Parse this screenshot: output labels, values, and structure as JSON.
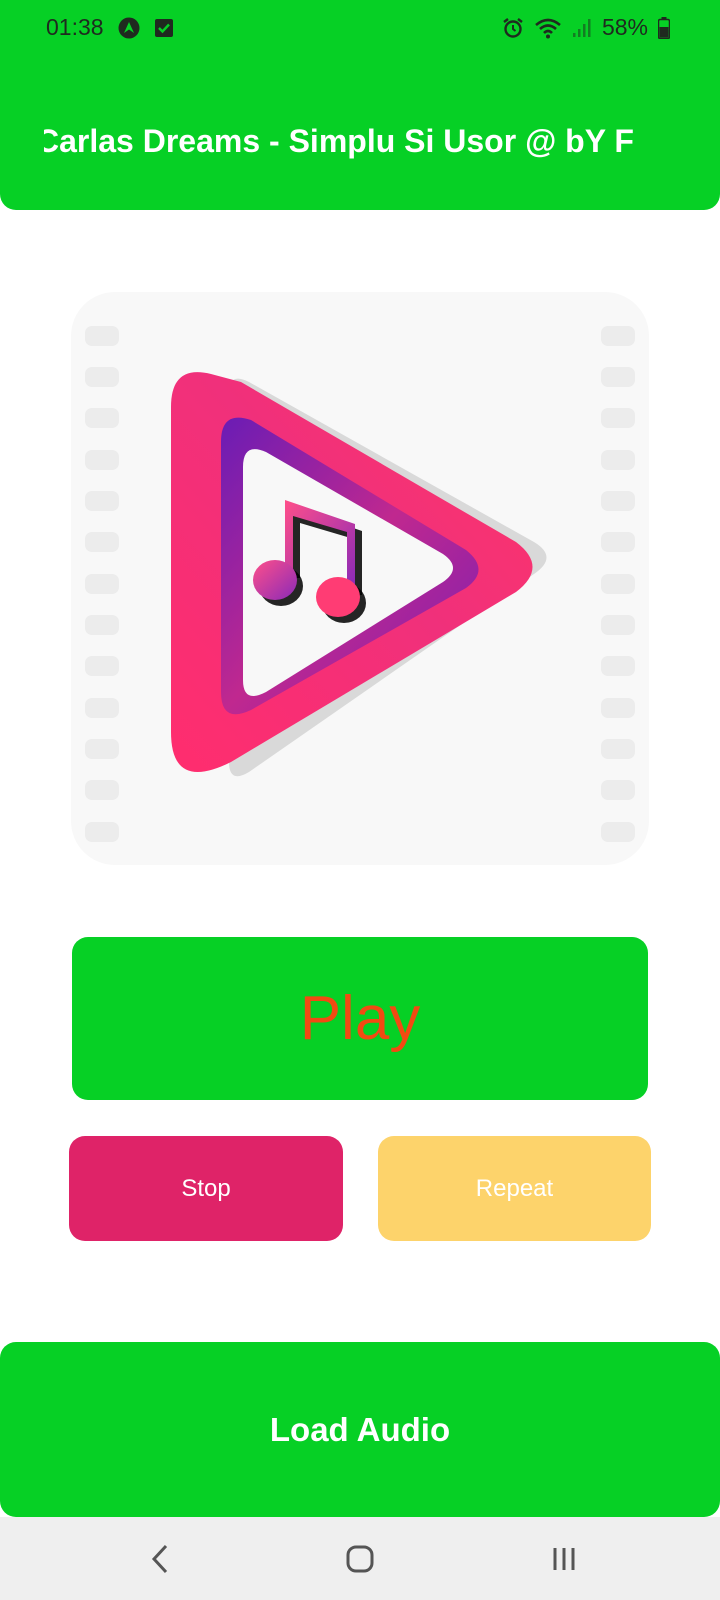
{
  "status_bar": {
    "time": "01:38",
    "battery_percent": "58%",
    "icons": [
      "android-auto-icon",
      "checkbox-notification-icon",
      "alarm-icon",
      "wifi-icon",
      "signal-icon",
      "battery-icon"
    ]
  },
  "header": {
    "title": "Carlas Dreams - Simplu Si Usor @ bY F"
  },
  "artwork": {
    "icon": "music-play-logo-icon",
    "colors": {
      "pink": "#fb2d6c",
      "purple": "#7a1fb3",
      "film_bg": "#f8f8f8",
      "film_hole": "#ececec"
    }
  },
  "controls": {
    "play_label": "Play",
    "stop_label": "Stop",
    "repeat_label": "Repeat",
    "load_label": "Load Audio"
  },
  "colors": {
    "green": "#06d025",
    "play_text": "#f24a12",
    "stop": "#df2368",
    "repeat": "#fdd36b"
  },
  "nav_bar": {
    "icons": [
      "back-icon",
      "home-icon",
      "recents-icon"
    ]
  }
}
